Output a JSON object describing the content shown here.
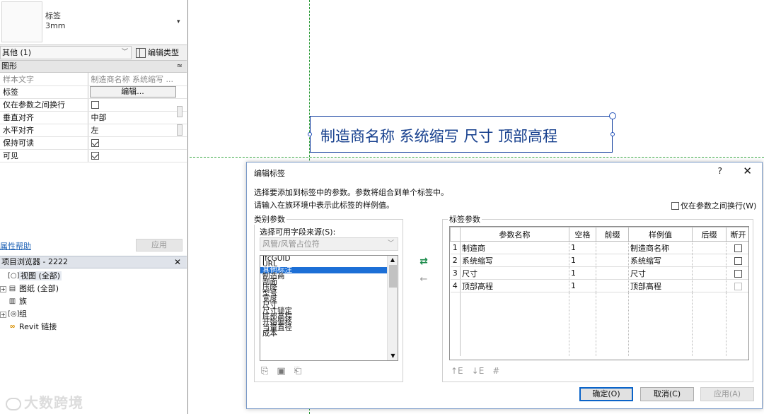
{
  "properties": {
    "type_name": "标签",
    "type_size": "3mm",
    "instance_filter": "其他 (1)",
    "edit_type_label": "编辑类型",
    "group_header": "图形",
    "rows": [
      {
        "key": "样本文字",
        "value": "制造商名称 系统缩写 ...",
        "kind": "text",
        "disabled": true
      },
      {
        "key": "标签",
        "value": "编辑...",
        "kind": "button"
      },
      {
        "key": "仅在参数之间换行",
        "value": "",
        "kind": "checkbox",
        "checked": false
      },
      {
        "key": "垂直对齐",
        "value": "中部",
        "kind": "text"
      },
      {
        "key": "水平对齐",
        "value": "左",
        "kind": "text"
      },
      {
        "key": "保持可读",
        "value": "",
        "kind": "checkbox",
        "checked": true
      },
      {
        "key": "可见",
        "value": "",
        "kind": "checkbox",
        "checked": true
      }
    ],
    "help_link": "属性帮助",
    "apply_label": "应用"
  },
  "project_browser": {
    "title": "项目浏览器 - 2222",
    "items": [
      {
        "label": "视图 (全部)",
        "expander": "",
        "icon": "view-icon",
        "selected": true
      },
      {
        "label": "图纸 (全部)",
        "expander": "+",
        "icon": "sheet-icon"
      },
      {
        "label": "族",
        "expander": "",
        "icon": "family-icon"
      },
      {
        "label": "组",
        "expander": "+",
        "icon": "group-icon"
      },
      {
        "label": "Revit 链接",
        "expander": "",
        "icon": "link-icon"
      }
    ]
  },
  "watermark": "大数跨境",
  "canvas": {
    "label_text": "制造商名称 系统缩写 尺寸 顶部高程"
  },
  "dialog": {
    "title": "编辑标签",
    "help": "?",
    "close": "✕",
    "instruction_1": "选择要添加到标签中的参数。参数将组合到单个标签中。",
    "instruction_2": "请输入在族环境中表示此标签的样例值。",
    "wrap_option": "仅在参数之间换行(W)",
    "category_group": {
      "legend": "类别参数",
      "source_label": "选择可用字段来源(S):",
      "source_value": "风管/风管占位符",
      "fields": [
        "IfcGUID",
        "URL",
        "其他标注",
        "制造商",
        "剖面",
        "压降",
        "型号",
        "宽度",
        "尺寸",
        "尺寸锁定",
        "底部高程",
        "开始偏移",
        "当量直径",
        "成本"
      ],
      "selected_field": "其他标注"
    },
    "tag_group": {
      "legend": "标签参数",
      "columns": [
        "",
        "参数名称",
        "空格",
        "前缀",
        "样例值",
        "后缀",
        "断开"
      ],
      "rows": [
        {
          "index": "1",
          "name": "制造商",
          "space": "1",
          "prefix": "",
          "sample": "制造商名称",
          "suffix": "",
          "break": false,
          "break_disabled": false
        },
        {
          "index": "2",
          "name": "系统缩写",
          "space": "1",
          "prefix": "",
          "sample": "系统缩写",
          "suffix": "",
          "break": false,
          "break_disabled": false
        },
        {
          "index": "3",
          "name": "尺寸",
          "space": "1",
          "prefix": "",
          "sample": "尺寸",
          "suffix": "",
          "break": false,
          "break_disabled": false
        },
        {
          "index": "4",
          "name": "顶部高程",
          "space": "1",
          "prefix": "",
          "sample": "顶部高程",
          "suffix": "",
          "break": false,
          "break_disabled": true
        }
      ]
    },
    "buttons": {
      "ok": "确定(O)",
      "cancel": "取消(C)",
      "apply": "应用(A)"
    }
  }
}
